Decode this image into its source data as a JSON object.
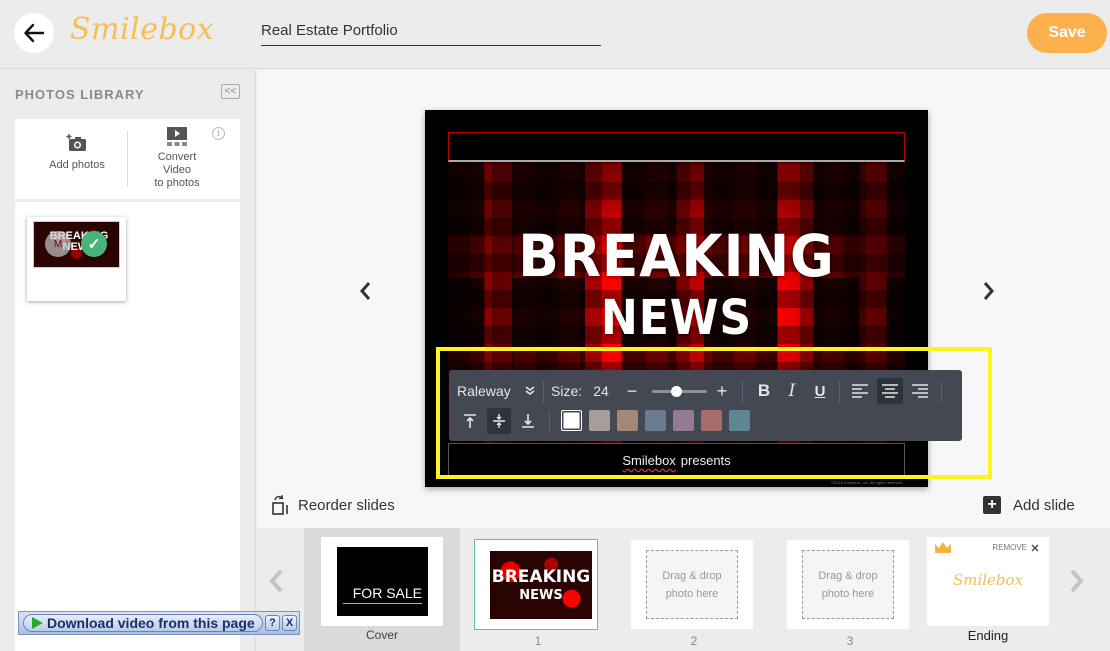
{
  "header": {
    "logo": "Smilebox",
    "project_title": "Real Estate Portfolio",
    "save_label": "Save"
  },
  "sidebar": {
    "title": "PHOTOS LIBRARY",
    "collapse_label": "<<",
    "add_photos_label": "Add photos",
    "convert_label_1": "Convert",
    "convert_label_2": "Video",
    "convert_label_3": "to photos",
    "info_label": "i",
    "photo_thumb_text": "BREAKING NEWS",
    "photo_thumb_badge": "M",
    "photo_check": "✓"
  },
  "slide": {
    "headline_1": "BREAKING",
    "headline_2": "NEWS",
    "caption_word_1": "Smilebox",
    "caption_word_2": "presents",
    "copyright": "©2016 Smilebox, Inc. All rights reserved"
  },
  "toolbar": {
    "font": "Raleway",
    "size_label": "Size:",
    "size_value": "24",
    "size_slider_fraction": 0.45,
    "minus": "−",
    "plus": "+",
    "bold": "B",
    "italic": "I",
    "underline": "U",
    "align_selected": "center",
    "valign_selected": "middle",
    "colors": [
      "#ffffff",
      "#a59d98",
      "#a38877",
      "#6b7a93",
      "#957b92",
      "#a56c6b",
      "#5f8592"
    ],
    "selected_color_index": 0
  },
  "stage": {
    "reorder_label": "Reorder slides",
    "add_slide_label": "Add slide"
  },
  "filmstrip": {
    "slides": [
      {
        "label": "Cover",
        "thumb_text": "FOR SALE"
      },
      {
        "label": "1",
        "thumb_text_1": "BREAKING",
        "thumb_text_2": "NEWS"
      },
      {
        "label": "2",
        "drop_1": "Drag & drop",
        "drop_2": "photo here"
      },
      {
        "label": "3",
        "drop_1": "Drag & drop",
        "drop_2": "photo here"
      },
      {
        "label": "Ending",
        "logo": "Smilebox",
        "remove_label": "REMOVE"
      }
    ]
  },
  "download_bar": {
    "label": "Download video from this page",
    "help": "?",
    "close": "X"
  }
}
